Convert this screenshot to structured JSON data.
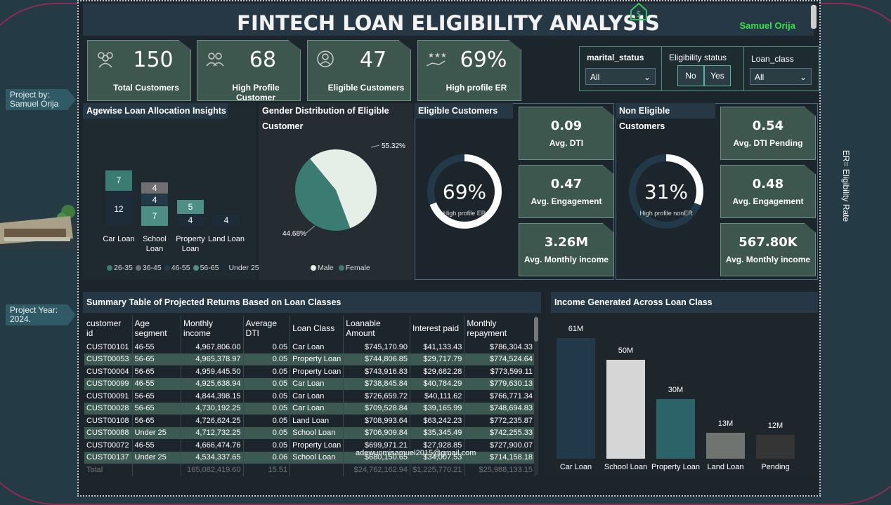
{
  "side": {
    "project_by": "Project by:",
    "project_by_name": "Samuel Orija",
    "project_year_label": "Project Year:",
    "project_year": "2024.",
    "er_note": "ER= Eligibility Rate"
  },
  "header": {
    "title": "FINTECH LOAN ELIGIBILITY ANALYSIS",
    "author": "Samuel Orija"
  },
  "kpis": [
    {
      "value": "150",
      "label": "Total Customers",
      "icon": "people-icon"
    },
    {
      "value": "68",
      "label": "High Profile Customer",
      "icon": "users-icon"
    },
    {
      "value": "47",
      "label": "Eligible Customers",
      "icon": "user-badge-icon"
    },
    {
      "value": "69%",
      "label": "High profile ER",
      "icon": "hand-stars-icon"
    }
  ],
  "filters": {
    "marital_status": {
      "label": "marital_status",
      "value": "All"
    },
    "eligibility_status": {
      "label": "Eligibility status",
      "no": "No",
      "yes": "Yes"
    },
    "loan_class": {
      "label": "Loan_class",
      "value": "All"
    }
  },
  "agewise": {
    "title": "Agewise Loan Allocation Insights",
    "legend": [
      "26-35",
      "36-45",
      "46-55",
      "56-65",
      "Under 25"
    ],
    "legend_colors": [
      "#3a7b72",
      "#707070",
      "#243a4a",
      "#4d8f85",
      "#1e2c3a"
    ],
    "categories": [
      "Car Loan",
      "School Loan",
      "Property Loan",
      "Land Loan"
    ]
  },
  "gender": {
    "title": "Gender Distribution of Eligible Customer",
    "male_pct": "55.32%",
    "female_pct": "44.68%",
    "legend_male": "Male",
    "legend_female": "Female"
  },
  "eligible": {
    "title": "Eligible Customers",
    "ring_value": "69%",
    "ring_label": "High profile ER",
    "ring_fraction": 0.69,
    "cards": [
      {
        "value": "0.09",
        "label": "Avg. DTI"
      },
      {
        "value": "0.47",
        "label": "Avg. Engagement"
      },
      {
        "value": "3.26M",
        "label": "Avg. Monthly income"
      }
    ]
  },
  "non_eligible": {
    "title": "Non Eligible Customers",
    "ring_value": "31%",
    "ring_label": "High profile nonER",
    "ring_fraction": 0.31,
    "cards": [
      {
        "value": "0.54",
        "label": "Avg. DTI Pending"
      },
      {
        "value": "0.48",
        "label": "Avg. Engagement"
      },
      {
        "value": "567.80K",
        "label": "Avg. Monthly income"
      }
    ]
  },
  "summary": {
    "title": "Summary Table of Projected Returns Based on Loan Classes",
    "columns": [
      "customer id",
      "Age segment",
      "Monthly income",
      "Average DTI",
      "Loan Class",
      "Loanable Amount",
      "Interest paid",
      "Monthly repayment"
    ],
    "rows": [
      [
        "CUST00101",
        "46-55",
        "4,967,806.00",
        "0.05",
        "Car Loan",
        "$745,170.90",
        "$41,133.43",
        "$786,304.33"
      ],
      [
        "CUST00053",
        "56-65",
        "4,965,378.97",
        "0.05",
        "Property Loan",
        "$744,806.85",
        "$29,717.79",
        "$774,524.64"
      ],
      [
        "CUST00004",
        "56-65",
        "4,959,445.50",
        "0.05",
        "Property Loan",
        "$743,916.83",
        "$29,682.28",
        "$773,599.11"
      ],
      [
        "CUST00099",
        "46-55",
        "4,925,638.94",
        "0.05",
        "Car Loan",
        "$738,845.84",
        "$40,784.29",
        "$779,630.13"
      ],
      [
        "CUST00091",
        "56-65",
        "4,844,398.15",
        "0.05",
        "Car Loan",
        "$726,659.72",
        "$40,111.62",
        "$766,771.34"
      ],
      [
        "CUST00028",
        "56-65",
        "4,730,192.25",
        "0.05",
        "Car Loan",
        "$709,528.84",
        "$39,165.99",
        "$748,694.83"
      ],
      [
        "CUST00108",
        "56-65",
        "4,726,624.25",
        "0.05",
        "Land Loan",
        "$708,993.64",
        "$63,242.23",
        "$772,235.87"
      ],
      [
        "CUST00088",
        "Under 25",
        "4,712,732.25",
        "0.05",
        "School Loan",
        "$706,909.84",
        "$35,345.49",
        "$742,255.33"
      ],
      [
        "CUST00072",
        "46-55",
        "4,666,474.76",
        "0.05",
        "Property Loan",
        "$699,971.21",
        "$27,928.85",
        "$727,900.07"
      ],
      [
        "CUST00137",
        "Under 25",
        "4,534,337.65",
        "0.06",
        "School Loan",
        "$680,150.65",
        "$34,007.53",
        "$714,158.18"
      ]
    ],
    "total": [
      "Total",
      "",
      "165,082,419.60",
      "15.51",
      "",
      "$24,762,162.94",
      "$1,225,770.21",
      "$25,988,133.15"
    ],
    "watermark": "adewunmisamuel2015@gmail.com"
  },
  "income_chart_title": "Income Generated Across Loan Class",
  "chart_data": [
    {
      "type": "bar",
      "stacked": true,
      "title": "Agewise Loan Allocation Insights",
      "categories": [
        "Car Loan",
        "School Loan",
        "Property Loan",
        "Land Loan"
      ],
      "series": [
        {
          "name": "26-35",
          "values": [
            7,
            0,
            0,
            0
          ]
        },
        {
          "name": "36-45",
          "values": [
            0,
            4,
            0,
            0
          ]
        },
        {
          "name": "46-55",
          "values": [
            0,
            4,
            0,
            0
          ]
        },
        {
          "name": "56-65",
          "values": [
            0,
            7,
            5,
            0
          ]
        },
        {
          "name": "Under 25",
          "values": [
            12,
            0,
            4,
            4
          ]
        }
      ]
    },
    {
      "type": "pie",
      "title": "Gender Distribution of Eligible Customer",
      "categories": [
        "Male",
        "Female"
      ],
      "values": [
        55.32,
        44.68
      ]
    },
    {
      "type": "bar",
      "title": "Income Generated Across Loan Class",
      "categories": [
        "Car Loan",
        "School Loan",
        "Property Loan",
        "Land Loan",
        "Pending"
      ],
      "values": [
        61,
        50,
        30,
        13,
        12
      ],
      "labels": [
        "61M",
        "50M",
        "30M",
        "13M",
        "12M"
      ],
      "colors": [
        "#22394a",
        "#d6d6d6",
        "#2b6368",
        "#707470",
        "#353535"
      ]
    }
  ]
}
